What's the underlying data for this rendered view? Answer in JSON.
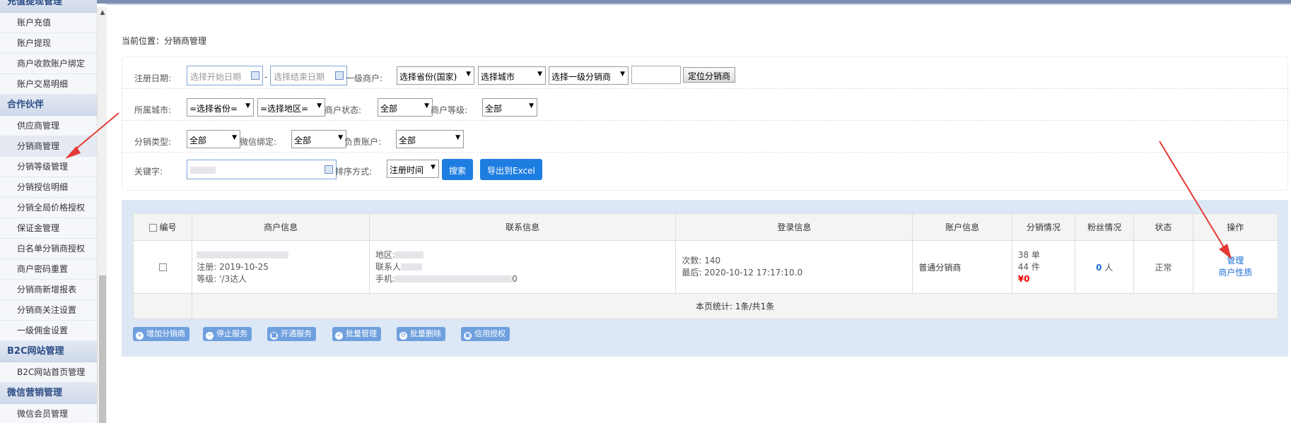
{
  "sidebar": {
    "items": [
      {
        "label": "充值提现管理",
        "type": "section"
      },
      {
        "label": "账户充值",
        "type": "item"
      },
      {
        "label": "账户提现",
        "type": "item"
      },
      {
        "label": "商户收款账户绑定",
        "type": "item"
      },
      {
        "label": "账户交易明细",
        "type": "item"
      },
      {
        "label": "合作伙伴",
        "type": "section"
      },
      {
        "label": "供应商管理",
        "type": "item"
      },
      {
        "label": "分销商管理",
        "type": "item",
        "selected": true
      },
      {
        "label": "分销等级管理",
        "type": "item"
      },
      {
        "label": "分销授信明细",
        "type": "item"
      },
      {
        "label": "分销全局价格授权",
        "type": "item"
      },
      {
        "label": "保证金管理",
        "type": "item"
      },
      {
        "label": "白名单分销商授权",
        "type": "item"
      },
      {
        "label": "商户密码重置",
        "type": "item"
      },
      {
        "label": "分销商新增报表",
        "type": "item"
      },
      {
        "label": "分销商关注设置",
        "type": "item"
      },
      {
        "label": "一级佣金设置",
        "type": "item"
      },
      {
        "label": "B2C网站管理",
        "type": "section"
      },
      {
        "label": "B2C网站首页管理",
        "type": "item"
      },
      {
        "label": "微信营销管理",
        "type": "section"
      },
      {
        "label": "微信会员管理",
        "type": "item"
      }
    ]
  },
  "breadcrumb": "当前位置：分销商管理",
  "filters": {
    "reg_date_label": "注册日期:",
    "start_placeholder": "选择开始日期",
    "end_placeholder": "选择结束日期",
    "date_sep": "-",
    "level1_label": "一级商户:",
    "province_country": "选择省份(国家)",
    "city": "选择城市",
    "level1_dist": "选择一级分销商",
    "locate_btn": "定位分销商",
    "city_label": "所属城市:",
    "province_sel": "=选择省份=",
    "area_sel": "=选择地区=",
    "status_label": "商户状态:",
    "status_val": "全部",
    "grade_label": "商户等级:",
    "grade_val": "全部",
    "dist_type_label": "分销类型:",
    "dist_type_val": "全部",
    "wechat_label": "微信绑定:",
    "wechat_val": "全部",
    "owner_label": "负责账户:",
    "owner_val": "全部",
    "keyword_label": "关键字:",
    "sort_label": "排序方式:",
    "sort_val": "注册时间",
    "search_btn": "搜索",
    "export_btn": "导出到Excel"
  },
  "table": {
    "headers": [
      "编号",
      "商户信息",
      "联系信息",
      "登录信息",
      "账户信息",
      "分销情况",
      "粉丝情况",
      "状态",
      "操作"
    ],
    "row": {
      "reg_date": "注册: 2019-10-25",
      "grade": "等级: '/3达人",
      "region": "地区:",
      "contact": "联系人",
      "phone": "手机:",
      "phone_tail": "0",
      "login_count": "次数: 140",
      "login_last": "最后: 2020-10-12 17:17:10.0",
      "account": "普通分销商",
      "orders": "38 单",
      "pieces": "44 件",
      "amount": "¥0",
      "fans_num": "0",
      "fans_unit": "人",
      "status": "正常",
      "op_manage": "管理",
      "op_nature": "商户性质"
    },
    "footer": "本页统计: 1条/共1条"
  },
  "actions": [
    {
      "icon": "plus-icon",
      "label": "增加分销商"
    },
    {
      "icon": "minus-icon",
      "label": "停止服务"
    },
    {
      "icon": "save-icon",
      "label": "开通服务"
    },
    {
      "icon": "check-icon",
      "label": "批量管理"
    },
    {
      "icon": "block-icon",
      "label": "批量删除"
    },
    {
      "icon": "lock-icon",
      "label": "信用授权"
    }
  ],
  "colors": {
    "accent": "#1e7de0",
    "annotation_arrow": "#e53935"
  }
}
